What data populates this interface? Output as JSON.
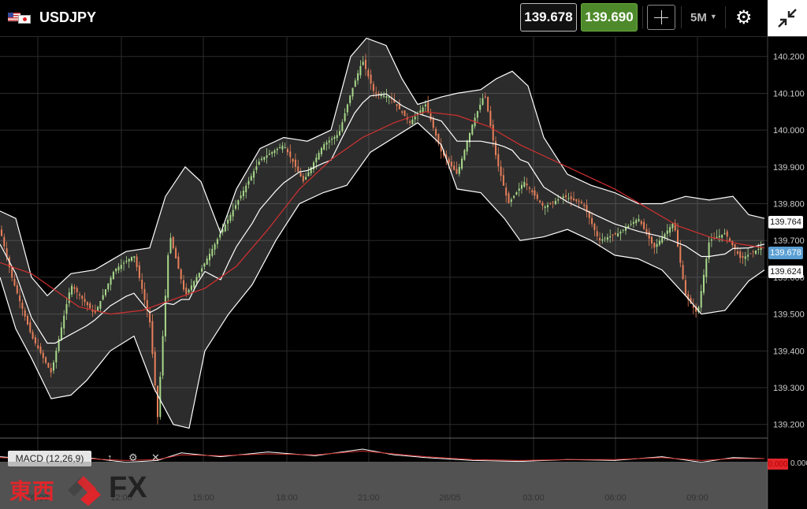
{
  "header": {
    "symbol": "USDJPY",
    "bid": "139.678",
    "ask": "139.690",
    "timeframe": "5M",
    "icons": [
      "usa-flag-icon",
      "japan-flag-icon",
      "crosshair-icon",
      "gear-icon",
      "collapse-icon"
    ]
  },
  "indicator": {
    "label": "MACD (12,26,9)",
    "zero_label": "0.000"
  },
  "logo": {
    "kanji": "東西",
    "fx": "FX"
  },
  "price_tags": {
    "upper": "139.764",
    "price": "139.678",
    "lower": "139.624"
  },
  "colors": {
    "bull": "#a8d98a",
    "bear": "#e8805a",
    "ma": "#d23030",
    "band": "#ffffff",
    "ask_bg": "#4e8a2b",
    "price_tag": "#5a9fd4"
  },
  "chart_data": {
    "type": "candlestick",
    "y_ticks": [
      "140.200",
      "140.100",
      "140.000",
      "139.900",
      "139.800",
      "139.700",
      "139.600",
      "139.500",
      "139.400",
      "139.300",
      "139.200"
    ],
    "ylim": [
      139.163,
      140.253
    ],
    "x_ticks": [
      "09:00",
      "12:00",
      "15:00",
      "18:00",
      "21:00",
      "26/05",
      "03:00",
      "06:00",
      "09:00"
    ],
    "indicators": [
      "Bollinger Bands",
      "Moving Average",
      "MACD (12,26,9)"
    ],
    "price_path": [
      [
        0,
        139.73
      ],
      [
        15,
        139.6
      ],
      [
        40,
        139.44
      ],
      [
        65,
        139.34
      ],
      [
        90,
        139.58
      ],
      [
        120,
        139.5
      ],
      [
        145,
        139.62
      ],
      [
        170,
        139.66
      ],
      [
        190,
        139.48
      ],
      [
        200,
        139.22
      ],
      [
        215,
        139.72
      ],
      [
        235,
        139.55
      ],
      [
        255,
        139.62
      ],
      [
        275,
        139.7
      ],
      [
        300,
        139.8
      ],
      [
        330,
        139.92
      ],
      [
        360,
        139.96
      ],
      [
        385,
        139.86
      ],
      [
        410,
        139.96
      ],
      [
        430,
        139.99
      ],
      [
        445,
        140.1
      ],
      [
        460,
        140.19
      ],
      [
        475,
        140.1
      ],
      [
        495,
        140.09
      ],
      [
        520,
        140.02
      ],
      [
        540,
        140.07
      ],
      [
        560,
        139.94
      ],
      [
        580,
        139.88
      ],
      [
        600,
        140.02
      ],
      [
        615,
        140.1
      ],
      [
        630,
        139.92
      ],
      [
        645,
        139.8
      ],
      [
        665,
        139.86
      ],
      [
        690,
        139.79
      ],
      [
        715,
        139.82
      ],
      [
        740,
        139.8
      ],
      [
        760,
        139.7
      ],
      [
        785,
        139.72
      ],
      [
        810,
        139.76
      ],
      [
        830,
        139.68
      ],
      [
        855,
        139.75
      ],
      [
        870,
        139.55
      ],
      [
        885,
        139.5
      ],
      [
        900,
        139.7
      ],
      [
        920,
        139.72
      ],
      [
        940,
        139.65
      ],
      [
        965,
        139.68
      ]
    ],
    "ma_path": [
      [
        0,
        139.64
      ],
      [
        40,
        139.61
      ],
      [
        100,
        139.52
      ],
      [
        140,
        139.5
      ],
      [
        180,
        139.51
      ],
      [
        220,
        139.54
      ],
      [
        260,
        139.57
      ],
      [
        300,
        139.63
      ],
      [
        340,
        139.73
      ],
      [
        380,
        139.84
      ],
      [
        420,
        139.92
      ],
      [
        460,
        139.98
      ],
      [
        500,
        140.02
      ],
      [
        540,
        140.05
      ],
      [
        580,
        140.04
      ],
      [
        620,
        140.01
      ],
      [
        660,
        139.96
      ],
      [
        700,
        139.92
      ],
      [
        740,
        139.88
      ],
      [
        780,
        139.84
      ],
      [
        820,
        139.79
      ],
      [
        860,
        139.74
      ],
      [
        900,
        139.71
      ],
      [
        940,
        139.69
      ],
      [
        970,
        139.68
      ]
    ],
    "bollinger_upper": [
      [
        0,
        139.78
      ],
      [
        20,
        139.76
      ],
      [
        40,
        139.6
      ],
      [
        60,
        139.55
      ],
      [
        90,
        139.61
      ],
      [
        120,
        139.62
      ],
      [
        160,
        139.67
      ],
      [
        190,
        139.68
      ],
      [
        210,
        139.82
      ],
      [
        235,
        139.9
      ],
      [
        255,
        139.86
      ],
      [
        280,
        139.72
      ],
      [
        300,
        139.84
      ],
      [
        330,
        139.95
      ],
      [
        360,
        139.98
      ],
      [
        390,
        139.97
      ],
      [
        420,
        140.0
      ],
      [
        445,
        140.2
      ],
      [
        465,
        140.25
      ],
      [
        490,
        140.23
      ],
      [
        510,
        140.14
      ],
      [
        530,
        140.07
      ],
      [
        560,
        140.09
      ],
      [
        580,
        140.1
      ],
      [
        610,
        140.11
      ],
      [
        630,
        140.14
      ],
      [
        650,
        140.16
      ],
      [
        670,
        140.12
      ],
      [
        690,
        139.98
      ],
      [
        720,
        139.88
      ],
      [
        750,
        139.85
      ],
      [
        780,
        139.83
      ],
      [
        810,
        139.8
      ],
      [
        840,
        139.8
      ],
      [
        870,
        139.82
      ],
      [
        900,
        139.81
      ],
      [
        930,
        139.82
      ],
      [
        950,
        139.77
      ],
      [
        970,
        139.76
      ]
    ],
    "bollinger_lower": [
      [
        0,
        139.6
      ],
      [
        20,
        139.46
      ],
      [
        40,
        139.38
      ],
      [
        65,
        139.27
      ],
      [
        90,
        139.28
      ],
      [
        110,
        139.32
      ],
      [
        140,
        139.4
      ],
      [
        170,
        139.44
      ],
      [
        195,
        139.3
      ],
      [
        220,
        139.2
      ],
      [
        240,
        139.19
      ],
      [
        260,
        139.4
      ],
      [
        290,
        139.5
      ],
      [
        320,
        139.58
      ],
      [
        350,
        139.7
      ],
      [
        380,
        139.8
      ],
      [
        410,
        139.83
      ],
      [
        440,
        139.85
      ],
      [
        470,
        139.94
      ],
      [
        500,
        139.98
      ],
      [
        530,
        140.02
      ],
      [
        560,
        139.96
      ],
      [
        580,
        139.84
      ],
      [
        610,
        139.83
      ],
      [
        640,
        139.76
      ],
      [
        660,
        139.7
      ],
      [
        690,
        139.71
      ],
      [
        720,
        139.73
      ],
      [
        750,
        139.7
      ],
      [
        780,
        139.66
      ],
      [
        810,
        139.65
      ],
      [
        840,
        139.62
      ],
      [
        870,
        139.55
      ],
      [
        890,
        139.5
      ],
      [
        920,
        139.51
      ],
      [
        950,
        139.59
      ],
      [
        970,
        139.62
      ]
    ],
    "macd_line": [
      [
        0,
        0.2
      ],
      [
        60,
        -0.2
      ],
      [
        110,
        0.1
      ],
      [
        160,
        -0.4
      ],
      [
        200,
        -0.2
      ],
      [
        230,
        0.6
      ],
      [
        280,
        0.2
      ],
      [
        340,
        0.7
      ],
      [
        400,
        0.3
      ],
      [
        460,
        1.0
      ],
      [
        500,
        0.4
      ],
      [
        540,
        0.1
      ],
      [
        600,
        -0.2
      ],
      [
        660,
        -0.3
      ],
      [
        720,
        -0.1
      ],
      [
        780,
        -0.2
      ],
      [
        840,
        0.2
      ],
      [
        890,
        -0.4
      ],
      [
        930,
        0.1
      ],
      [
        970,
        0.0
      ]
    ],
    "signal_line": [
      [
        0,
        0.1
      ],
      [
        60,
        -0.1
      ],
      [
        110,
        0.0
      ],
      [
        160,
        -0.2
      ],
      [
        200,
        -0.1
      ],
      [
        230,
        0.4
      ],
      [
        280,
        0.3
      ],
      [
        340,
        0.5
      ],
      [
        400,
        0.4
      ],
      [
        460,
        0.8
      ],
      [
        500,
        0.5
      ],
      [
        540,
        0.2
      ],
      [
        600,
        -0.1
      ],
      [
        660,
        -0.2
      ],
      [
        720,
        -0.1
      ],
      [
        780,
        -0.1
      ],
      [
        840,
        0.1
      ],
      [
        890,
        -0.2
      ],
      [
        930,
        0.0
      ],
      [
        970,
        0.0
      ]
    ]
  }
}
